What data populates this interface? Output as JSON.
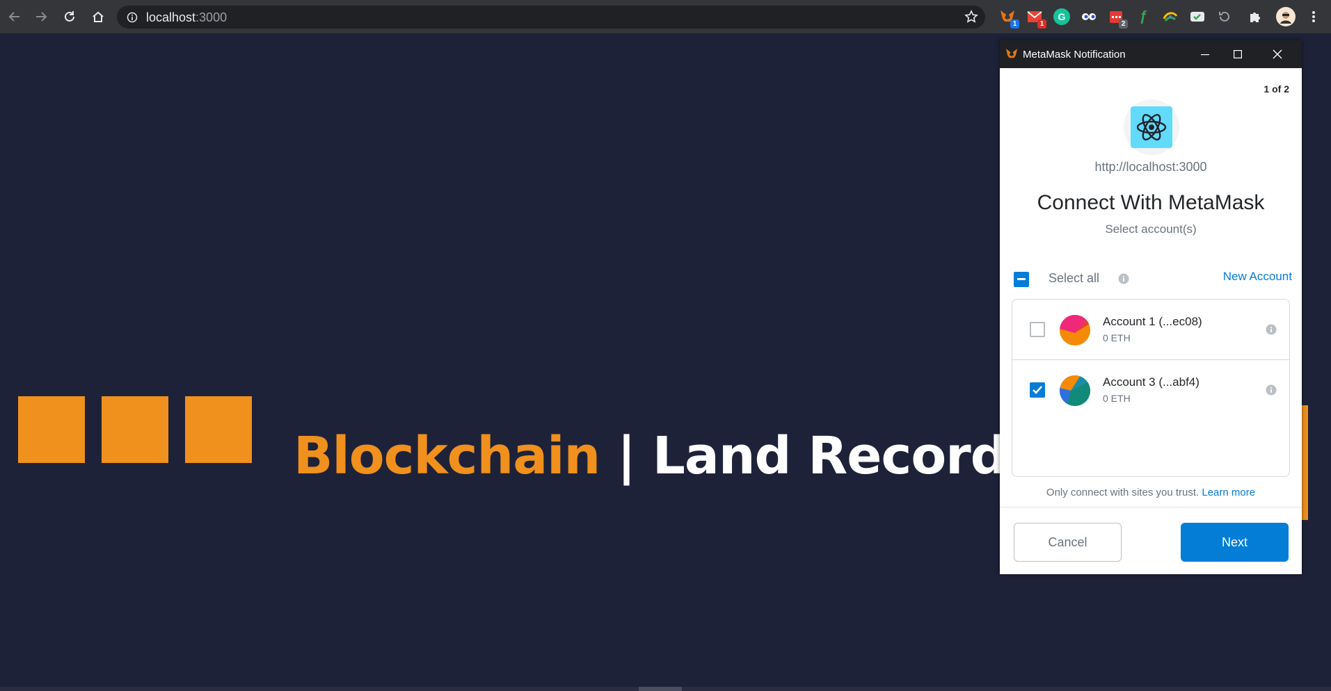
{
  "browser": {
    "url_host": "localhost",
    "url_port": ":3000",
    "extensions": [
      {
        "name": "metamask-extension-icon",
        "badge": "1"
      },
      {
        "name": "gmail-extension-icon",
        "badge": "1"
      },
      {
        "name": "grammarly-extension-icon",
        "letter": "G"
      },
      {
        "name": "eyes-extension-icon"
      },
      {
        "name": "calendar-extension-icon",
        "badge": "2"
      },
      {
        "name": "f-extension-icon",
        "letter": "ƒ"
      },
      {
        "name": "tab-extension-icon"
      },
      {
        "name": "mail-check-extension-icon"
      },
      {
        "name": "history-extension-icon"
      },
      {
        "name": "puzzle-extensions-icon"
      }
    ]
  },
  "page": {
    "title_highlight": "Blockchain",
    "title_rest": "| Land Records Syste",
    "colors": {
      "background": "#1e2239",
      "accent": "#f0901d"
    }
  },
  "metamask": {
    "window_title": "MetaMask Notification",
    "counter": "1 of 2",
    "origin": "http://localhost:3000",
    "heading": "Connect With MetaMask",
    "subheading": "Select account(s)",
    "select_all_label": "Select all",
    "new_account_label": "New Account",
    "accounts": [
      {
        "name": "Account 1 (...ec08)",
        "balance": "0 ETH",
        "checked": false
      },
      {
        "name": "Account 3 (...abf4)",
        "balance": "0 ETH",
        "checked": true
      }
    ],
    "trust_text": "Only connect with sites you trust.",
    "learn_more": "Learn more",
    "cancel_label": "Cancel",
    "next_label": "Next",
    "colors": {
      "primary": "#037dd6"
    }
  }
}
